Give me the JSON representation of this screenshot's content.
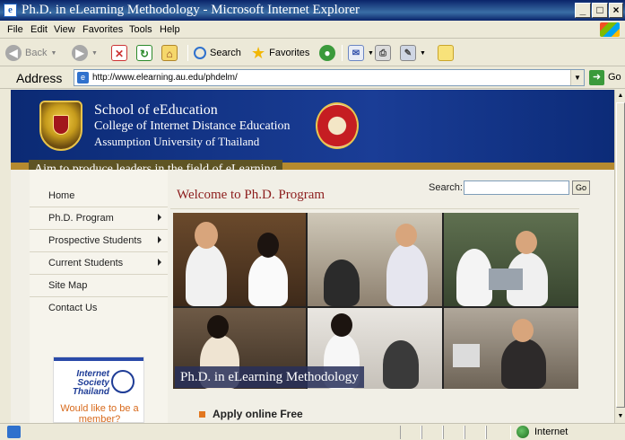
{
  "window": {
    "title": "Ph.D. in eLearning Methodology - Microsoft Internet Explorer",
    "minimize": "_",
    "maximize": "□",
    "close": "×"
  },
  "menu": [
    "File",
    "Edit",
    "View",
    "Favorites",
    "Tools",
    "Help"
  ],
  "toolbar": {
    "back": "Back",
    "search": "Search",
    "favorites": "Favorites"
  },
  "address": {
    "label": "Address",
    "url": "http://www.elearning.au.edu/phdelm/",
    "go": "Go"
  },
  "page": {
    "header": {
      "school": "School of eEducation",
      "college": "College of Internet Distance Education",
      "university": "Assumption University of Thailand"
    },
    "tagline": "Aim to produce leaders in the field of eLearning",
    "nav": [
      {
        "label": "Home",
        "has_submenu": false
      },
      {
        "label": "Ph.D. Program",
        "has_submenu": true
      },
      {
        "label": "Prospective Students",
        "has_submenu": true
      },
      {
        "label": "Current Students",
        "has_submenu": true
      },
      {
        "label": "Site Map",
        "has_submenu": false
      },
      {
        "label": "Contact Us",
        "has_submenu": false
      }
    ],
    "welcome": "Welcome to Ph.D. Program",
    "search": {
      "label": "Search:",
      "value": "",
      "button": "Go"
    },
    "banner_caption": "Ph.D. in eLearning Methodology",
    "isoc": {
      "name_line1": "Internet",
      "name_line2": "Society",
      "name_line3": "Thailand",
      "prompt": "Would like to be a member?"
    },
    "apply": "Apply online Free"
  },
  "status": {
    "zone": "Internet"
  },
  "colors": {
    "header_blue": "#0b2a74",
    "tagline_bg": "#5e5424",
    "welcome_red": "#8c1c1c",
    "bullet_orange": "#e2771f"
  }
}
